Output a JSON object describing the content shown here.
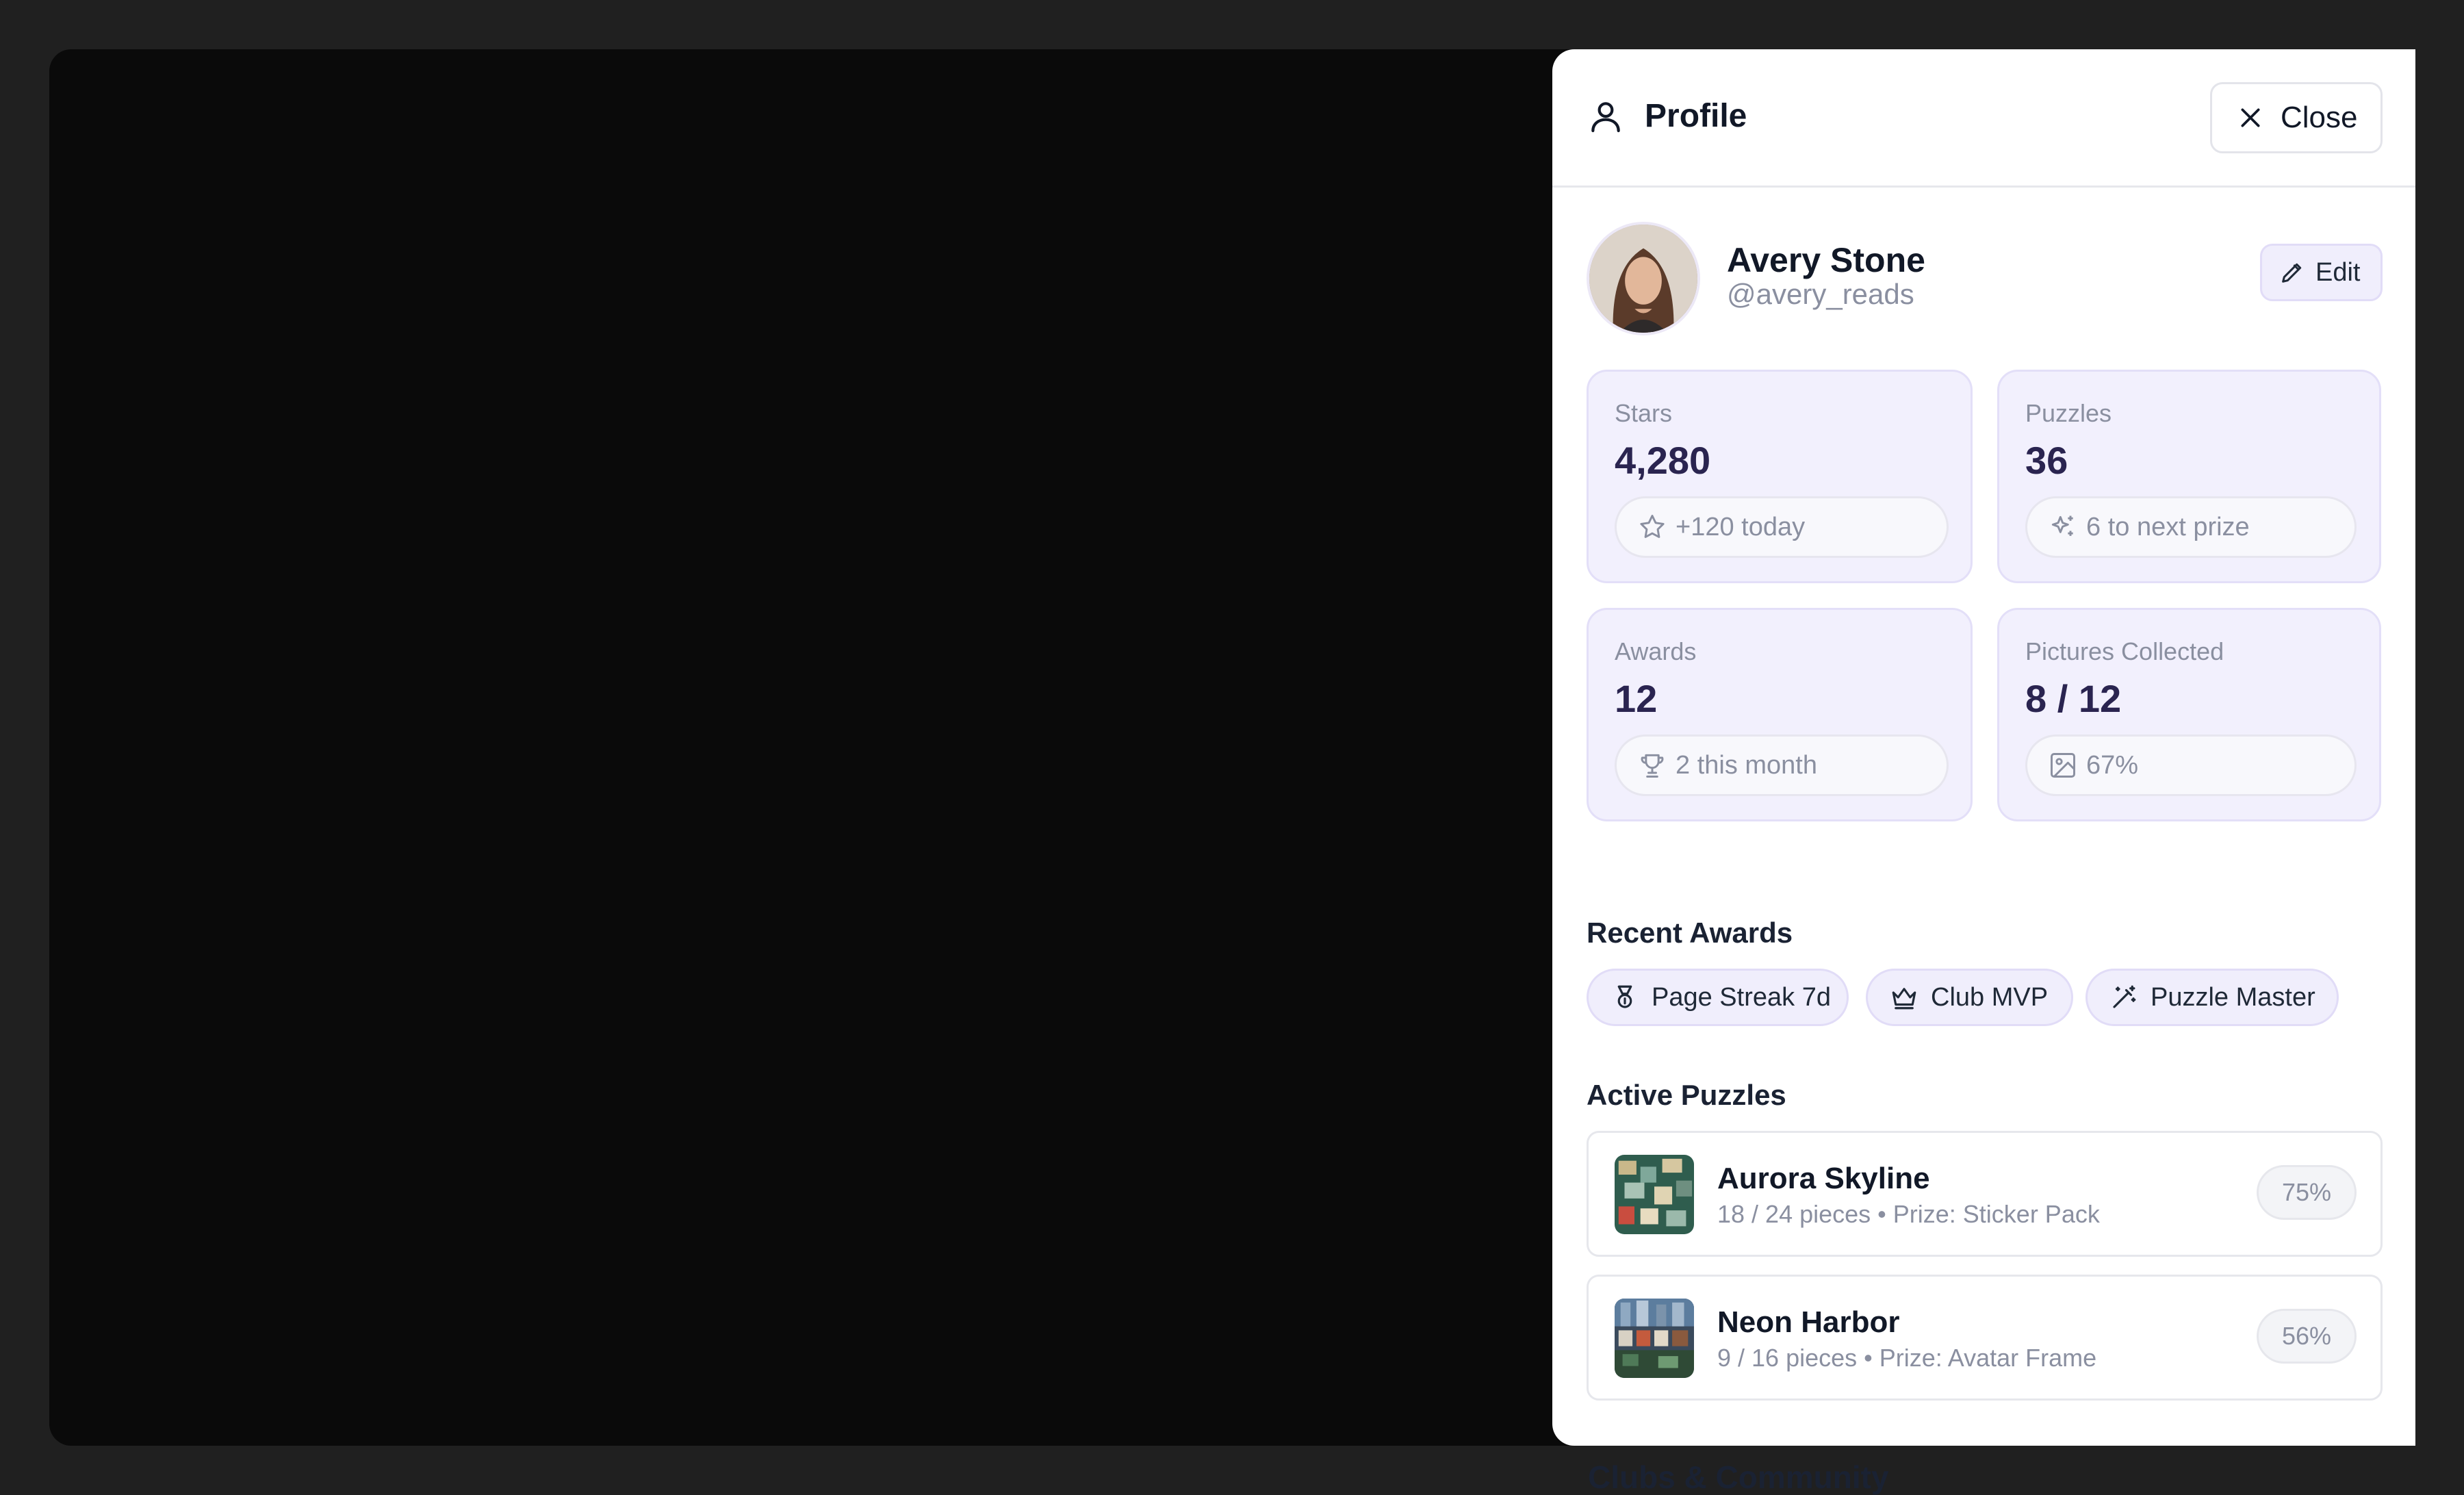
{
  "below_panel": {
    "title": "Clubs & Community"
  },
  "header": {
    "title": "Profile",
    "close_label": "Close"
  },
  "user": {
    "name": "Avery Stone",
    "handle": "@avery_reads",
    "edit_label": "Edit"
  },
  "stats": [
    {
      "label": "Stars",
      "value": "4,280",
      "note": "+120 today",
      "icon": "star-icon"
    },
    {
      "label": "Puzzles",
      "value": "36",
      "note": "6 to next prize",
      "icon": "sparkles-icon"
    },
    {
      "label": "Awards",
      "value": "12",
      "note": "2 this month",
      "icon": "trophy-icon"
    },
    {
      "label": "Pictures Collected",
      "value": "8 / 12",
      "note": "67%",
      "icon": "image-icon"
    }
  ],
  "recent_awards": {
    "title": "Recent Awards",
    "items": [
      {
        "label": "Page Streak 7d",
        "icon": "medal-icon"
      },
      {
        "label": "Club MVP",
        "icon": "crown-icon"
      },
      {
        "label": "Puzzle Master",
        "icon": "magic-wand-icon"
      }
    ]
  },
  "active_puzzles": {
    "title": "Active Puzzles",
    "items": [
      {
        "name": "Aurora Skyline",
        "meta": "18 / 24 pieces • Prize: Sticker Pack",
        "percent": "75%"
      },
      {
        "name": "Neon Harbor",
        "meta": "9 / 16 pieces • Prize: Avatar Frame",
        "percent": "56%"
      }
    ]
  },
  "colors": {
    "accent_bg": "#f2f0fd",
    "accent_border": "#e3dff8",
    "value_text": "#2a2450",
    "muted_text": "#8a8fa0",
    "backdrop": "#0a0a0a"
  }
}
